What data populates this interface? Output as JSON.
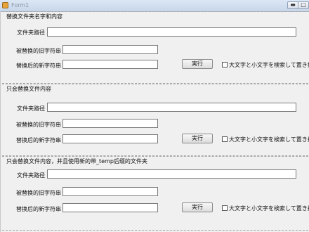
{
  "window": {
    "title": "Form1",
    "minimize_icon": "minimize-icon",
    "maximize_icon": "maximize-icon"
  },
  "groups": [
    {
      "title": "替换文件夹名字和内容",
      "folder_path_label": "文件夹路径",
      "folder_path_value": "",
      "old_string_label": "被替换的旧字符串",
      "old_string_value": "",
      "new_string_label": "替换后的新字符串",
      "new_string_value": "",
      "execute_label": "実行",
      "case_checkbox_label": "大文字と小文字を検索して置き換え",
      "case_checked": false
    },
    {
      "title": "只会替换文件内容",
      "folder_path_label": "文件夹路径",
      "folder_path_value": "",
      "old_string_label": "被替换的旧字符串",
      "old_string_value": "",
      "new_string_label": "替换后的新字符串",
      "new_string_value": "",
      "execute_label": "実行",
      "case_checkbox_label": "大文字と小文字を検索して置き換え",
      "case_checked": false
    },
    {
      "title": "只会替换文件内容，并且使用新的带_temp后缀的文件夹",
      "folder_path_label": "文件夹路径",
      "folder_path_value": "",
      "old_string_label": "被替换的旧字符串",
      "old_string_value": "",
      "new_string_label": "替换后的新字符串",
      "new_string_value": "",
      "execute_label": "実行",
      "case_checkbox_label": "大文字と小文字を検索して置き換え",
      "case_checked": false
    }
  ]
}
